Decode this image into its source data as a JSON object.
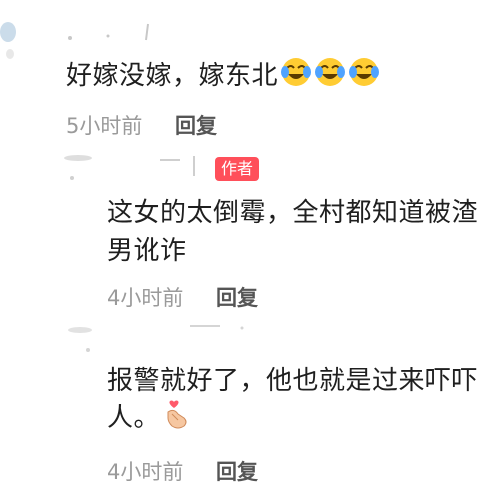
{
  "comments": [
    {
      "text": "好嫁没嫁，嫁东北",
      "emojis": [
        "laughing-crying-face",
        "laughing-crying-face",
        "laughing-crying-face"
      ],
      "time": "5小时前",
      "reply_label": "回复"
    },
    {
      "author_badge": "作者",
      "line1": "这女的太倒霉，全村都知道被渣",
      "line2": "男讹诈",
      "time": "4小时前",
      "reply_label": "回复"
    },
    {
      "line1": "报警就好了，他也就是过来吓吓",
      "line2": "人。",
      "emoji": "finger-heart",
      "time": "4小时前",
      "reply_label": "回复"
    }
  ],
  "colors": {
    "badge": "#ff4f5a",
    "text": "#1f1f1f",
    "meta": "#9a9a9a",
    "reply": "#555555"
  }
}
